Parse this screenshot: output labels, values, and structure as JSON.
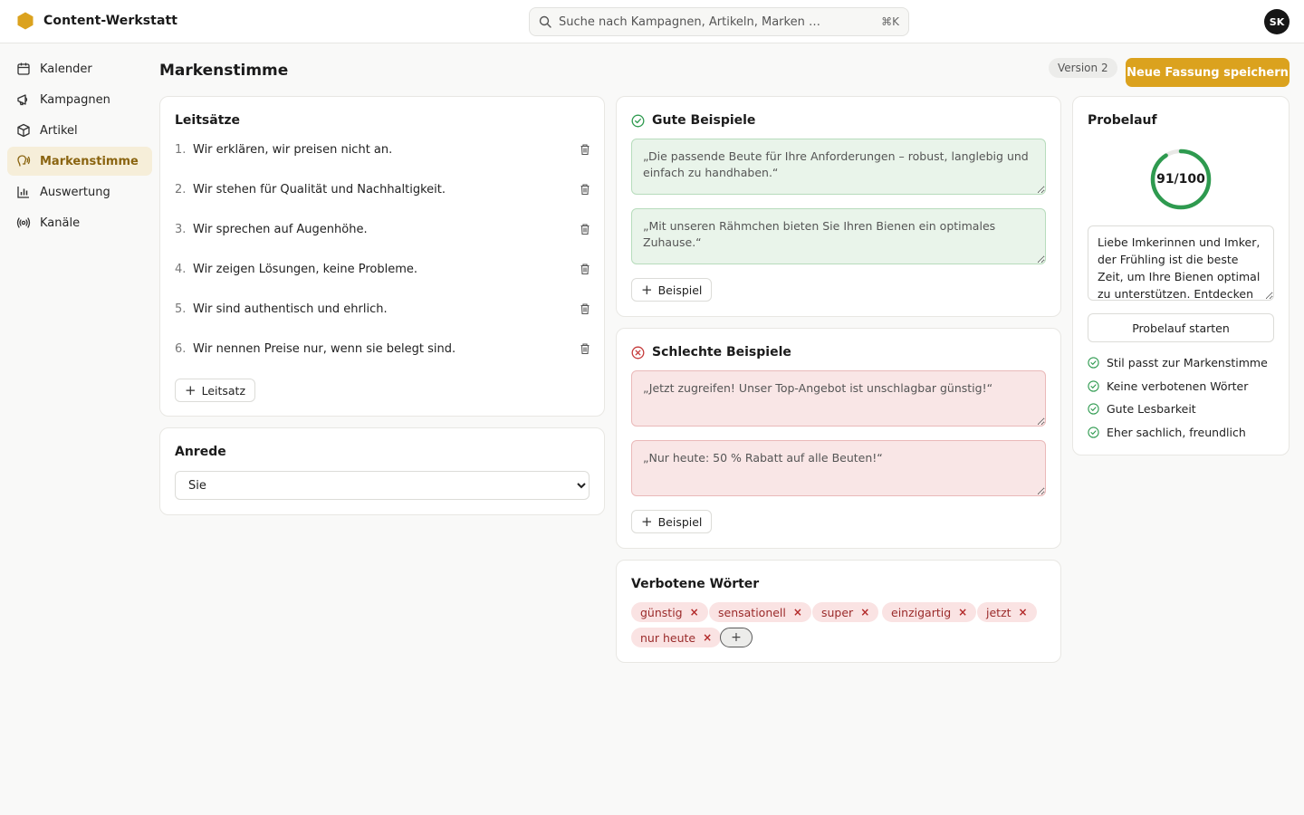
{
  "app": {
    "name": "Content-Werkstatt",
    "search_placeholder": "Suche nach Kampagnen, Artikeln, Marken …",
    "search_shortcut": "⌘K",
    "user_initials": "SK",
    "accent_color": "#dba21e"
  },
  "sidebar": {
    "items": [
      {
        "label": "Kalender",
        "icon": "calendar-icon"
      },
      {
        "label": "Kampagnen",
        "icon": "megaphone-icon"
      },
      {
        "label": "Artikel",
        "icon": "box-icon"
      },
      {
        "label": "Markenstimme",
        "icon": "voice-icon",
        "active": true
      },
      {
        "label": "Auswertung",
        "icon": "bar-chart-icon"
      },
      {
        "label": "Kanäle",
        "icon": "broadcast-icon"
      }
    ]
  },
  "header": {
    "title": "Markenstimme",
    "version": "Version 2",
    "save_label": "Neue Fassung speichern"
  },
  "principles": {
    "title": "Leitsätze",
    "items": [
      {
        "num": "1.",
        "text": "Wir erklären, wir preisen nicht an."
      },
      {
        "num": "2.",
        "text": "Wir stehen für Qualität und Nachhaltigkeit."
      },
      {
        "num": "3.",
        "text": "Wir sprechen auf Augenhöhe."
      },
      {
        "num": "4.",
        "text": "Wir zeigen Lösungen, keine Probleme."
      },
      {
        "num": "5.",
        "text": "Wir sind authentisch und ehrlich."
      },
      {
        "num": "6.",
        "text": "Wir nennen Preise nur, wenn sie belegt sind."
      }
    ],
    "add_label": "Leitsatz"
  },
  "address": {
    "title": "Anrede",
    "selected": "Sie"
  },
  "good_examples": {
    "title": "Gute Beispiele",
    "items": [
      "„Die passende Beute für Ihre Anforderungen – robust, langlebig und einfach zu handhaben.“",
      "„Mit unseren Rähmchen bieten Sie Ihren Bienen ein optimales Zuhause.“"
    ],
    "add_label": "Beispiel"
  },
  "bad_examples": {
    "title": "Schlechte Beispiele",
    "items": [
      "„Jetzt zugreifen! Unser Top-Angebot ist unschlagbar günstig!“",
      "„Nur heute: 50 % Rabatt auf alle Beuten!“"
    ],
    "add_label": "Beispiel"
  },
  "forbidden": {
    "title": "Verbotene Wörter",
    "words": [
      "günstig",
      "sensationell",
      "super",
      "einzigartig",
      "jetzt",
      "nur heute"
    ]
  },
  "trial": {
    "title": "Probelauf",
    "score": 91,
    "score_max": 100,
    "score_label": "91/100",
    "sample_text": "Liebe Imkerinnen und Imker, der Frühling ist die beste Zeit, um Ihre Bienen optimal zu unterstützen. Entdecken Sie",
    "run_label": "Probelauf starten",
    "checks": [
      "Stil passt zur Markenstimme",
      "Keine verbotenen Wörter",
      "Gute Lesbarkeit",
      "Eher sachlich, freundlich"
    ],
    "score_color": "#2e9a4f"
  }
}
